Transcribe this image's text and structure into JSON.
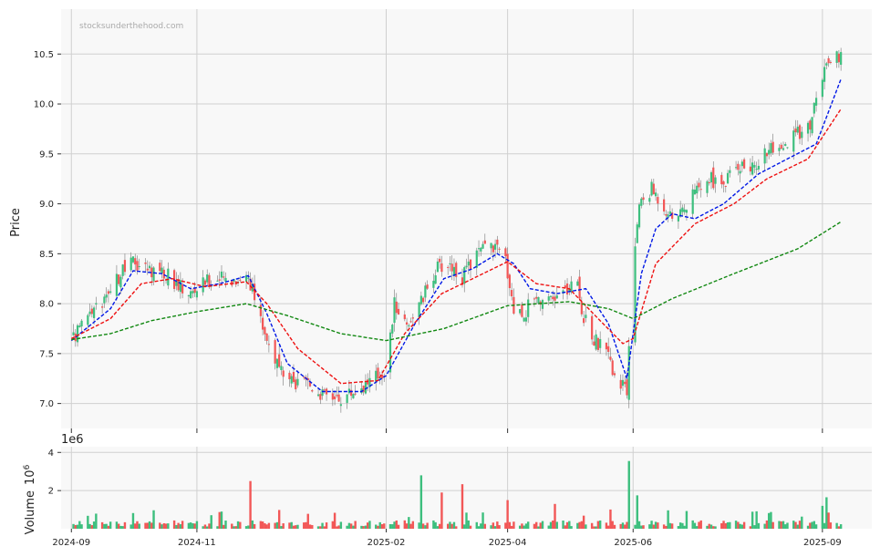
{
  "watermark": "stocksunderthehood.com",
  "colors": {
    "panel_bg": "#f8f8f8",
    "grid": "#d0d0d0",
    "up": "#3dbf7e",
    "down": "#f25757",
    "ma_short": "#0018e6",
    "ma_mid": "#ee1111",
    "ma_long": "#118811"
  },
  "chart_data": {
    "type": "candlestick",
    "price_panel": {
      "ylabel": "Price",
      "ylim": [
        6.75,
        10.95
      ],
      "yticks": [
        "7.0",
        "7.5",
        "8.0",
        "8.5",
        "9.0",
        "9.5",
        "10.0",
        "10.5"
      ],
      "grid": true
    },
    "volume_panel": {
      "ylabel": "Volume",
      "scale_label": "1e6",
      "offset_label": "10",
      "offset_exponent": "6",
      "ylim": [
        0,
        4.3
      ],
      "yticks": [
        "2",
        "4"
      ],
      "grid": true
    },
    "x_axis": {
      "range": [
        "2024-08-27",
        "2025-09-25"
      ],
      "ticks": [
        "2024-09",
        "2024-11",
        "2025-02",
        "2025-04",
        "2025-06",
        "2025-09"
      ],
      "tick_dates": [
        "2024-09-01",
        "2024-11-01",
        "2025-02-01",
        "2025-04-01",
        "2025-06-01",
        "2025-09-01"
      ]
    },
    "series": [
      {
        "name": "",
        "kind": "close",
        "points": [
          [
            "2024-09-01",
            7.62
          ],
          [
            "2024-09-10",
            7.9
          ],
          [
            "2024-09-18",
            8.02
          ],
          [
            "2024-09-25",
            8.3
          ],
          [
            "2024-10-01",
            8.42
          ],
          [
            "2024-10-08",
            8.35
          ],
          [
            "2024-10-15",
            8.33
          ],
          [
            "2024-10-22",
            8.2
          ],
          [
            "2024-10-29",
            8.1
          ],
          [
            "2024-11-05",
            8.22
          ],
          [
            "2024-11-12",
            8.25
          ],
          [
            "2024-11-19",
            8.25
          ],
          [
            "2024-11-26",
            8.28
          ],
          [
            "2024-12-01",
            7.9
          ],
          [
            "2024-12-06",
            7.6
          ],
          [
            "2024-12-12",
            7.3
          ],
          [
            "2024-12-18",
            7.18
          ],
          [
            "2024-12-25",
            7.2
          ],
          [
            "2025-01-02",
            7.08
          ],
          [
            "2025-01-10",
            7.06
          ],
          [
            "2025-01-18",
            7.15
          ],
          [
            "2025-01-26",
            7.25
          ],
          [
            "2025-02-01",
            7.35
          ],
          [
            "2025-02-05",
            8.0
          ],
          [
            "2025-02-11",
            7.8
          ],
          [
            "2025-02-18",
            8.02
          ],
          [
            "2025-02-25",
            8.35
          ],
          [
            "2025-03-04",
            8.4
          ],
          [
            "2025-03-10",
            8.25
          ],
          [
            "2025-03-17",
            8.5
          ],
          [
            "2025-03-24",
            8.6
          ],
          [
            "2025-03-31",
            8.45
          ],
          [
            "2025-04-04",
            7.95
          ],
          [
            "2025-04-09",
            7.9
          ],
          [
            "2025-04-14",
            8.1
          ],
          [
            "2025-04-21",
            8.0
          ],
          [
            "2025-04-28",
            8.12
          ],
          [
            "2025-05-05",
            8.18
          ],
          [
            "2025-05-08",
            7.85
          ],
          [
            "2025-05-13",
            7.65
          ],
          [
            "2025-05-19",
            7.5
          ],
          [
            "2025-05-24",
            7.25
          ],
          [
            "2025-05-29",
            7.1
          ],
          [
            "2025-06-01",
            8.4
          ],
          [
            "2025-06-04",
            9.0
          ],
          [
            "2025-06-10",
            9.15
          ],
          [
            "2025-06-17",
            8.95
          ],
          [
            "2025-06-24",
            8.88
          ],
          [
            "2025-07-01",
            9.1
          ],
          [
            "2025-07-08",
            9.25
          ],
          [
            "2025-07-15",
            9.2
          ],
          [
            "2025-07-22",
            9.4
          ],
          [
            "2025-07-29",
            9.35
          ],
          [
            "2025-08-05",
            9.55
          ],
          [
            "2025-08-12",
            9.5
          ],
          [
            "2025-08-19",
            9.7
          ],
          [
            "2025-08-26",
            9.8
          ],
          [
            "2025-09-01",
            10.3
          ],
          [
            "2025-09-08",
            10.45
          ]
        ]
      },
      {
        "name": "",
        "kind": "ma_short",
        "points": [
          [
            "2024-09-01",
            7.63
          ],
          [
            "2024-09-20",
            7.95
          ],
          [
            "2024-10-01",
            8.33
          ],
          [
            "2024-10-15",
            8.3
          ],
          [
            "2024-10-29",
            8.15
          ],
          [
            "2024-11-12",
            8.2
          ],
          [
            "2024-11-26",
            8.28
          ],
          [
            "2024-12-05",
            7.9
          ],
          [
            "2024-12-15",
            7.4
          ],
          [
            "2025-01-01",
            7.12
          ],
          [
            "2025-01-20",
            7.12
          ],
          [
            "2025-02-01",
            7.28
          ],
          [
            "2025-02-15",
            7.8
          ],
          [
            "2025-03-01",
            8.25
          ],
          [
            "2025-03-15",
            8.35
          ],
          [
            "2025-03-27",
            8.5
          ],
          [
            "2025-04-04",
            8.4
          ],
          [
            "2025-04-12",
            8.15
          ],
          [
            "2025-04-25",
            8.1
          ],
          [
            "2025-05-09",
            8.15
          ],
          [
            "2025-05-20",
            7.8
          ],
          [
            "2025-05-29",
            7.25
          ],
          [
            "2025-06-05",
            8.3
          ],
          [
            "2025-06-12",
            8.75
          ],
          [
            "2025-06-20",
            8.9
          ],
          [
            "2025-07-01",
            8.85
          ],
          [
            "2025-07-15",
            9.0
          ],
          [
            "2025-08-01",
            9.3
          ],
          [
            "2025-08-15",
            9.45
          ],
          [
            "2025-08-29",
            9.6
          ],
          [
            "2025-09-10",
            10.25
          ]
        ]
      },
      {
        "name": "",
        "kind": "ma_mid",
        "points": [
          [
            "2024-09-01",
            7.65
          ],
          [
            "2024-09-20",
            7.85
          ],
          [
            "2024-10-05",
            8.2
          ],
          [
            "2024-10-20",
            8.25
          ],
          [
            "2024-11-05",
            8.17
          ],
          [
            "2024-11-25",
            8.22
          ],
          [
            "2024-12-05",
            8.0
          ],
          [
            "2024-12-20",
            7.55
          ],
          [
            "2025-01-10",
            7.2
          ],
          [
            "2025-01-28",
            7.23
          ],
          [
            "2025-02-10",
            7.7
          ],
          [
            "2025-02-28",
            8.1
          ],
          [
            "2025-03-15",
            8.25
          ],
          [
            "2025-04-01",
            8.42
          ],
          [
            "2025-04-15",
            8.2
          ],
          [
            "2025-05-01",
            8.15
          ],
          [
            "2025-05-15",
            7.85
          ],
          [
            "2025-05-27",
            7.6
          ],
          [
            "2025-06-01",
            7.65
          ],
          [
            "2025-06-12",
            8.4
          ],
          [
            "2025-07-01",
            8.8
          ],
          [
            "2025-07-20",
            9.0
          ],
          [
            "2025-08-05",
            9.25
          ],
          [
            "2025-08-25",
            9.45
          ],
          [
            "2025-09-10",
            9.95
          ]
        ]
      },
      {
        "name": "",
        "kind": "ma_long",
        "points": [
          [
            "2024-09-01",
            7.64
          ],
          [
            "2024-09-20",
            7.7
          ],
          [
            "2024-10-10",
            7.83
          ],
          [
            "2024-11-01",
            7.92
          ],
          [
            "2024-11-25",
            8.0
          ],
          [
            "2024-12-15",
            7.88
          ],
          [
            "2025-01-10",
            7.7
          ],
          [
            "2025-02-01",
            7.63
          ],
          [
            "2025-03-01",
            7.75
          ],
          [
            "2025-04-01",
            7.98
          ],
          [
            "2025-05-01",
            8.02
          ],
          [
            "2025-05-20",
            7.95
          ],
          [
            "2025-06-01",
            7.85
          ],
          [
            "2025-06-20",
            8.05
          ],
          [
            "2025-07-20",
            8.3
          ],
          [
            "2025-08-20",
            8.55
          ],
          [
            "2025-09-10",
            8.82
          ]
        ]
      }
    ],
    "volume_spikes": [
      [
        "2024-11-27",
        2.5
      ],
      [
        "2025-02-18",
        2.8
      ],
      [
        "2025-02-28",
        1.9
      ],
      [
        "2025-03-22",
        3.8
      ],
      [
        "2025-03-10",
        1.6
      ],
      [
        "2025-04-24",
        1.3
      ],
      [
        "2025-05-30",
        3.55
      ],
      [
        "2025-06-01",
        2.4
      ],
      [
        "2025-06-03",
        1.75
      ],
      [
        "2025-09-03",
        1.65
      ],
      [
        "2025-09-01",
        1.2
      ],
      [
        "2025-04-01",
        1.5
      ]
    ]
  }
}
